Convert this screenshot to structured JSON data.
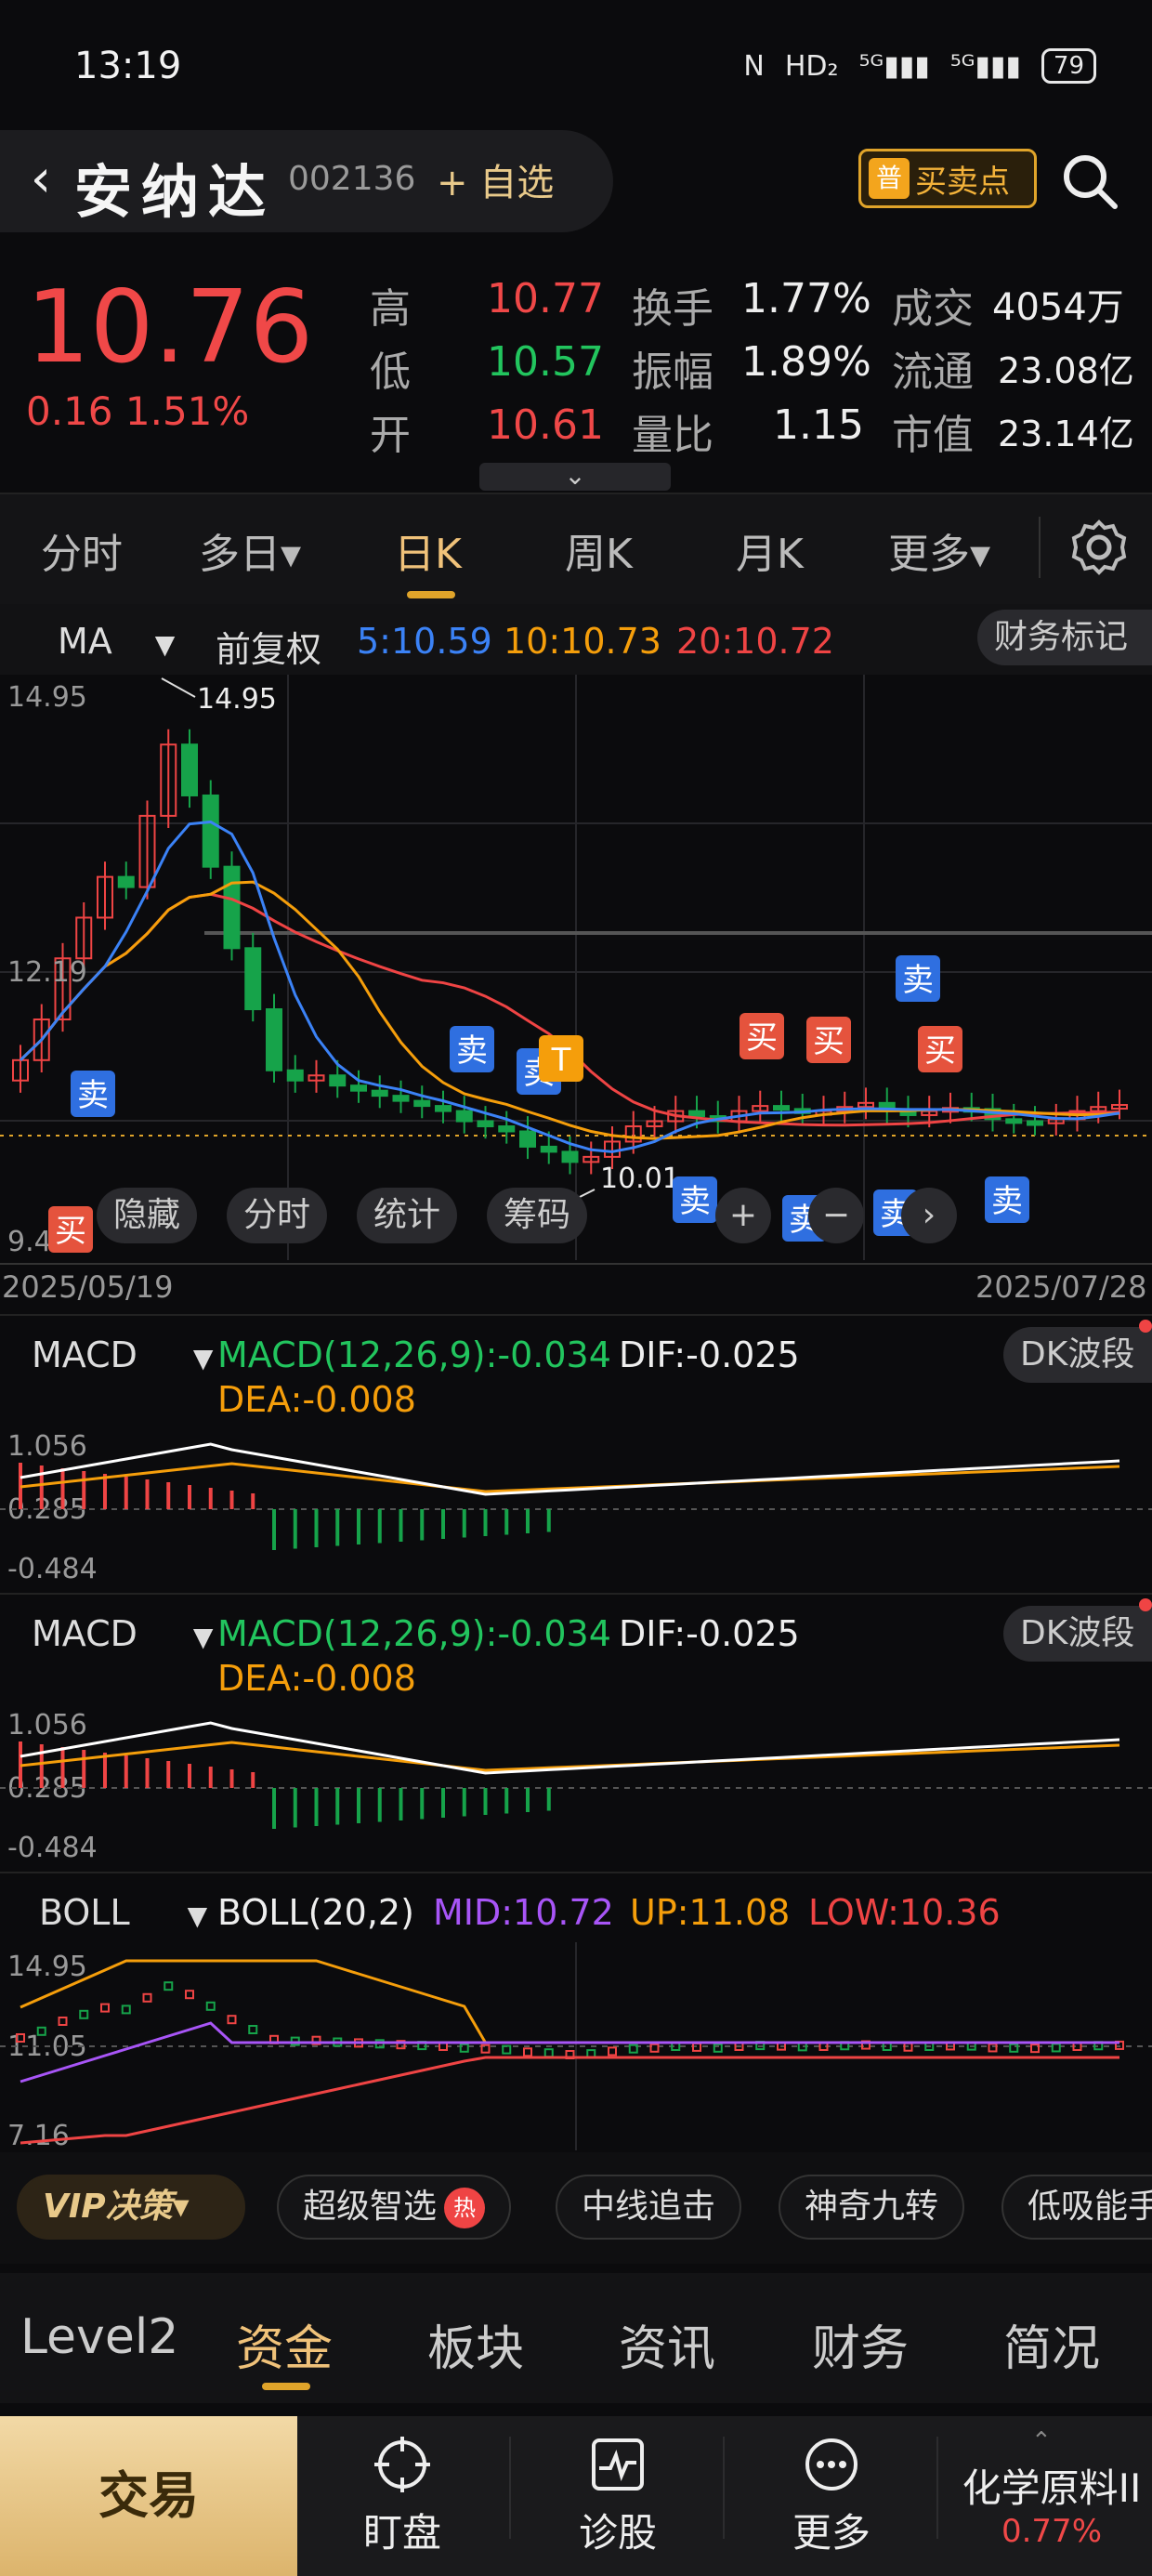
{
  "status_bar": {
    "time": "13:19",
    "icons": [
      "N",
      "HD₂",
      "⁵ᴳ▮▮▮",
      "⁵ᴳ▮▮▮"
    ],
    "battery": "79"
  },
  "header": {
    "stock_name": "安纳达",
    "stock_code": "002136",
    "add_watch": "+ 自选",
    "buy_sell_badge": "普",
    "buy_sell_label": "买卖点"
  },
  "quote": {
    "price": "10.76",
    "change": "0.16",
    "change_pct": "1.51%",
    "rows": [
      [
        {
          "label": "高",
          "value": "10.77",
          "color": "red"
        },
        {
          "label": "换手",
          "value": "1.77%"
        },
        {
          "label": "成交",
          "value": "4054万"
        }
      ],
      [
        {
          "label": "低",
          "value": "10.57",
          "color": "green"
        },
        {
          "label": "振幅",
          "value": "1.89%"
        },
        {
          "label": "流通",
          "value": "23.08亿"
        }
      ],
      [
        {
          "label": "开",
          "value": "10.61",
          "color": "red"
        },
        {
          "label": "量比",
          "value": "1.15"
        },
        {
          "label": "市值",
          "value": "23.14亿"
        }
      ]
    ]
  },
  "period_tabs": [
    "分时",
    "多日▾",
    "日K",
    "周K",
    "月K",
    "更多▾"
  ],
  "period_active": 2,
  "main_chart": {
    "indicator": "MA",
    "adjust": "前复权",
    "ma5": "5:10.59",
    "ma10": "10:10.73",
    "ma20": "20:10.72",
    "fin_marker": "财务标记",
    "y_high": "14.95",
    "y_mid": "12.19",
    "y_low": "9.4",
    "high_label": "14.95",
    "low_label": "10.01",
    "date_start": "2025/05/19",
    "date_end": "2025/07/28",
    "overlay_chips": [
      "隐藏",
      "分时",
      "统计",
      "筹码"
    ],
    "colors": {
      "ma5": "#3b82f6",
      "ma10": "#f59e0b",
      "ma20": "#ef4444"
    }
  },
  "signals": {
    "buy": "买",
    "sell": "卖",
    "t": "T"
  },
  "macd_panels": [
    {
      "name": "MACD",
      "params": "MACD(12,26,9):-0.034",
      "dif": "DIF:-0.025",
      "dea": "DEA:-0.008",
      "btn": "DK波段",
      "y_top": "1.056",
      "y_mid": "0.285",
      "y_bot": "-0.484"
    },
    {
      "name": "MACD",
      "params": "MACD(12,26,9):-0.034",
      "dif": "DIF:-0.025",
      "dea": "DEA:-0.008",
      "btn": "DK波段",
      "y_top": "1.056",
      "y_mid": "0.285",
      "y_bot": "-0.484"
    }
  ],
  "boll": {
    "name": "BOLL",
    "params": "BOLL(20,2)",
    "mid": "MID:10.72",
    "up": "UP:11.08",
    "low": "LOW:10.36",
    "y_top": "14.95",
    "y_mid": "11.05",
    "y_bot": "7.16"
  },
  "vip_bar": {
    "vip": "VIP决策▾",
    "chips": [
      "超级智选",
      "中线追击",
      "神奇九转",
      "低吸能手"
    ],
    "hot": "热"
  },
  "bottom_tabs": [
    "Level2",
    "资金",
    "板块",
    "资讯",
    "财务",
    "简况"
  ],
  "bottom_active": 1,
  "dock": {
    "trade": "交易",
    "items": [
      "盯盘",
      "诊股",
      "更多"
    ],
    "sector_name": "化学原料II",
    "sector_change": "0.77%"
  }
}
